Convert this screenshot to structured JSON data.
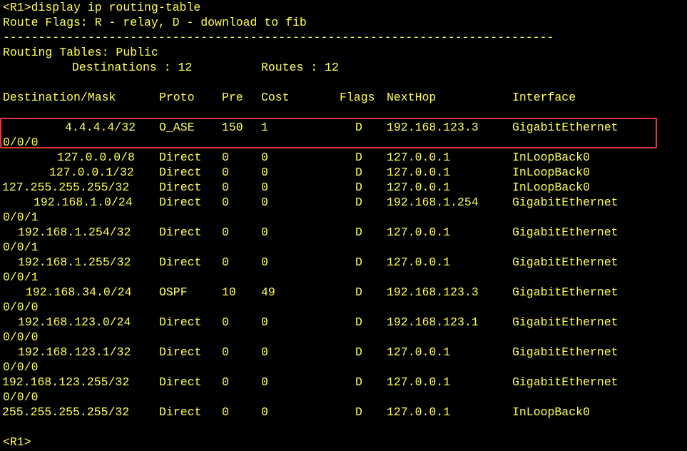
{
  "terminal": {
    "command_line": "<R1>display ip routing-table",
    "flags_line": "Route Flags: R - relay, D - download to fib",
    "separator": "------------------------------------------------------------------------------",
    "table_title": "Routing Tables: Public",
    "destinations_label": "Destinations : 12",
    "routes_label": "Routes : 12",
    "headers": {
      "destination": "Destination/Mask",
      "proto": "Proto",
      "pre": "Pre",
      "cost": "Cost",
      "flags": "Flags",
      "nexthop": "NextHop",
      "interface": "Interface"
    },
    "routes": [
      {
        "dest": "4.4.4.4/32",
        "proto": "O_ASE",
        "pre": "150",
        "cost": "1",
        "flags": "D",
        "nexthop": "192.168.123.3",
        "iface": "GigabitEthernet",
        "cont": "0/0/0"
      },
      {
        "dest": "127.0.0.0/8",
        "proto": "Direct",
        "pre": "0",
        "cost": "0",
        "flags": "D",
        "nexthop": "127.0.0.1",
        "iface": "InLoopBack0",
        "cont": ""
      },
      {
        "dest": "127.0.0.1/32",
        "proto": "Direct",
        "pre": "0",
        "cost": "0",
        "flags": "D",
        "nexthop": "127.0.0.1",
        "iface": "InLoopBack0",
        "cont": ""
      },
      {
        "dest": "127.255.255.255/32",
        "proto": "Direct",
        "pre": "0",
        "cost": "0",
        "flags": "D",
        "nexthop": "127.0.0.1",
        "iface": "InLoopBack0",
        "cont": ""
      },
      {
        "dest": "192.168.1.0/24",
        "proto": "Direct",
        "pre": "0",
        "cost": "0",
        "flags": "D",
        "nexthop": "192.168.1.254",
        "iface": "GigabitEthernet",
        "cont": "0/0/1"
      },
      {
        "dest": "192.168.1.254/32",
        "proto": "Direct",
        "pre": "0",
        "cost": "0",
        "flags": "D",
        "nexthop": "127.0.0.1",
        "iface": "GigabitEthernet",
        "cont": "0/0/1"
      },
      {
        "dest": "192.168.1.255/32",
        "proto": "Direct",
        "pre": "0",
        "cost": "0",
        "flags": "D",
        "nexthop": "127.0.0.1",
        "iface": "GigabitEthernet",
        "cont": "0/0/1"
      },
      {
        "dest": "192.168.34.0/24",
        "proto": "OSPF",
        "pre": "10",
        "cost": "49",
        "flags": "D",
        "nexthop": "192.168.123.3",
        "iface": "GigabitEthernet",
        "cont": "0/0/0"
      },
      {
        "dest": "192.168.123.0/24",
        "proto": "Direct",
        "pre": "0",
        "cost": "0",
        "flags": "D",
        "nexthop": "192.168.123.1",
        "iface": "GigabitEthernet",
        "cont": "0/0/0"
      },
      {
        "dest": "192.168.123.1/32",
        "proto": "Direct",
        "pre": "0",
        "cost": "0",
        "flags": "D",
        "nexthop": "127.0.0.1",
        "iface": "GigabitEthernet",
        "cont": "0/0/0"
      },
      {
        "dest": "192.168.123.255/32",
        "proto": "Direct",
        "pre": "0",
        "cost": "0",
        "flags": "D",
        "nexthop": "127.0.0.1",
        "iface": "GigabitEthernet",
        "cont": "0/0/0"
      },
      {
        "dest": "255.255.255.255/32",
        "proto": "Direct",
        "pre": "0",
        "cost": "0",
        "flags": "D",
        "nexthop": "127.0.0.1",
        "iface": "InLoopBack0",
        "cont": ""
      }
    ],
    "prompt": "<R1>",
    "colors": {
      "background": "#000000",
      "text": "#ffff55",
      "highlight_border": "#e53935"
    }
  }
}
